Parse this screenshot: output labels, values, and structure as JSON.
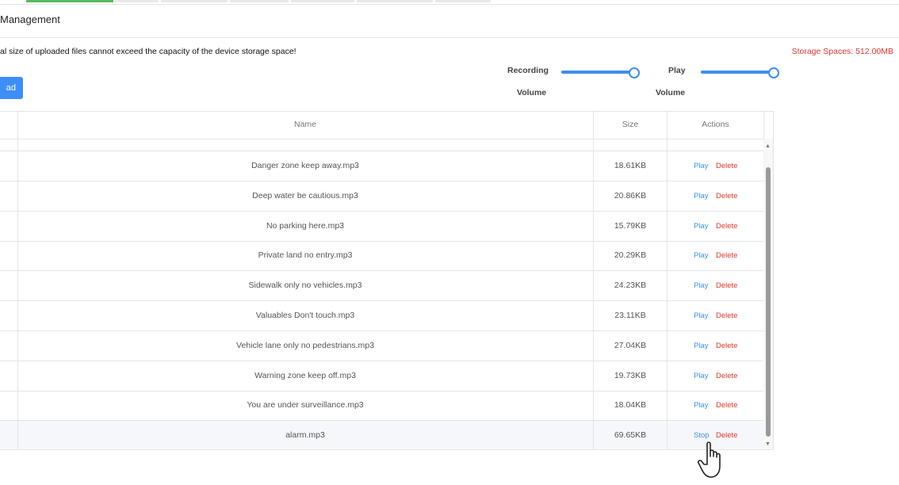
{
  "header": {
    "title": "Management"
  },
  "notice": "al size of uploaded files cannot exceed the capacity of the device storage space!",
  "storage": "Storage Spaces: 512.00MB",
  "upload_label": "ad",
  "sliders": {
    "recording_label_1": "Recording",
    "recording_label_2": "Volume",
    "recording_level": 1.0,
    "play_label_1": "Play",
    "play_label_2": "Volume",
    "play_level": 1.0
  },
  "table": {
    "columns": [
      "Name",
      "Size",
      "Actions"
    ],
    "rows": [
      {
        "name": "Danger zone keep away.mp3",
        "size": "18.61KB",
        "action": "Play",
        "delete": "Delete"
      },
      {
        "name": "Deep water be cautious.mp3",
        "size": "20.86KB",
        "action": "Play",
        "delete": "Delete"
      },
      {
        "name": "No parking here.mp3",
        "size": "15.79KB",
        "action": "Play",
        "delete": "Delete"
      },
      {
        "name": "Private land no entry.mp3",
        "size": "20.29KB",
        "action": "Play",
        "delete": "Delete"
      },
      {
        "name": "Sidewalk only no vehicles.mp3",
        "size": "24.23KB",
        "action": "Play",
        "delete": "Delete"
      },
      {
        "name": "Valuables Don't touch.mp3",
        "size": "23.11KB",
        "action": "Play",
        "delete": "Delete"
      },
      {
        "name": "Vehicle lane only no pedestrians.mp3",
        "size": "27.04KB",
        "action": "Play",
        "delete": "Delete"
      },
      {
        "name": "Warning zone keep off.mp3",
        "size": "19.73KB",
        "action": "Play",
        "delete": "Delete"
      },
      {
        "name": "You are under surveillance.mp3",
        "size": "18.04KB",
        "action": "Play",
        "delete": "Delete"
      },
      {
        "name": "alarm.mp3",
        "size": "69.65KB",
        "action": "Stop",
        "delete": "Delete"
      }
    ]
  },
  "colors": {
    "accent": "#3d8ef7",
    "danger": "#e0362c"
  },
  "icons": [
    "hand-pointer-icon",
    "scroll-up-icon",
    "scroll-down-icon"
  ]
}
